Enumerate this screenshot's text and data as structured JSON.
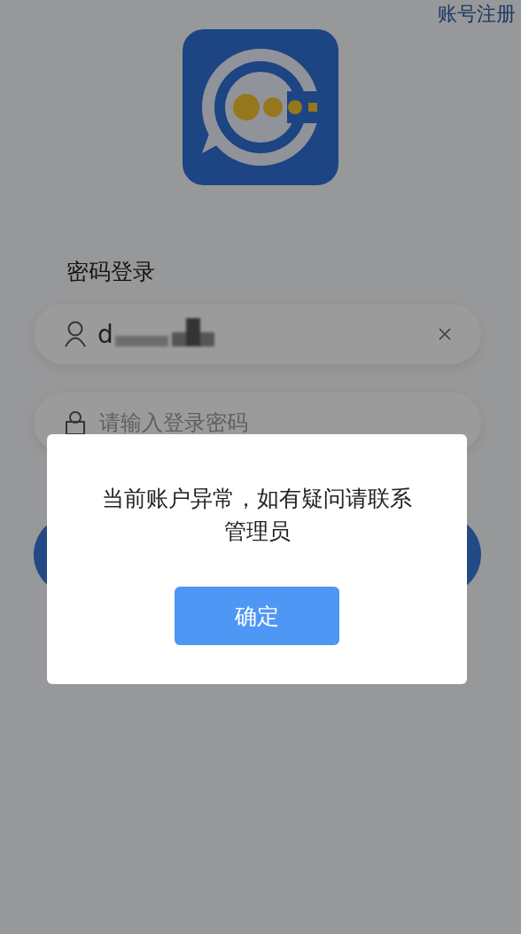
{
  "header": {
    "register_link": "账号注册"
  },
  "login": {
    "title": "密码登录",
    "username": {
      "value": "d",
      "redacted": true
    },
    "password": {
      "placeholder": "请输入登录密码"
    }
  },
  "dialog": {
    "message": "当前账户异常，如有疑问请联系管理员",
    "button": "确定"
  }
}
